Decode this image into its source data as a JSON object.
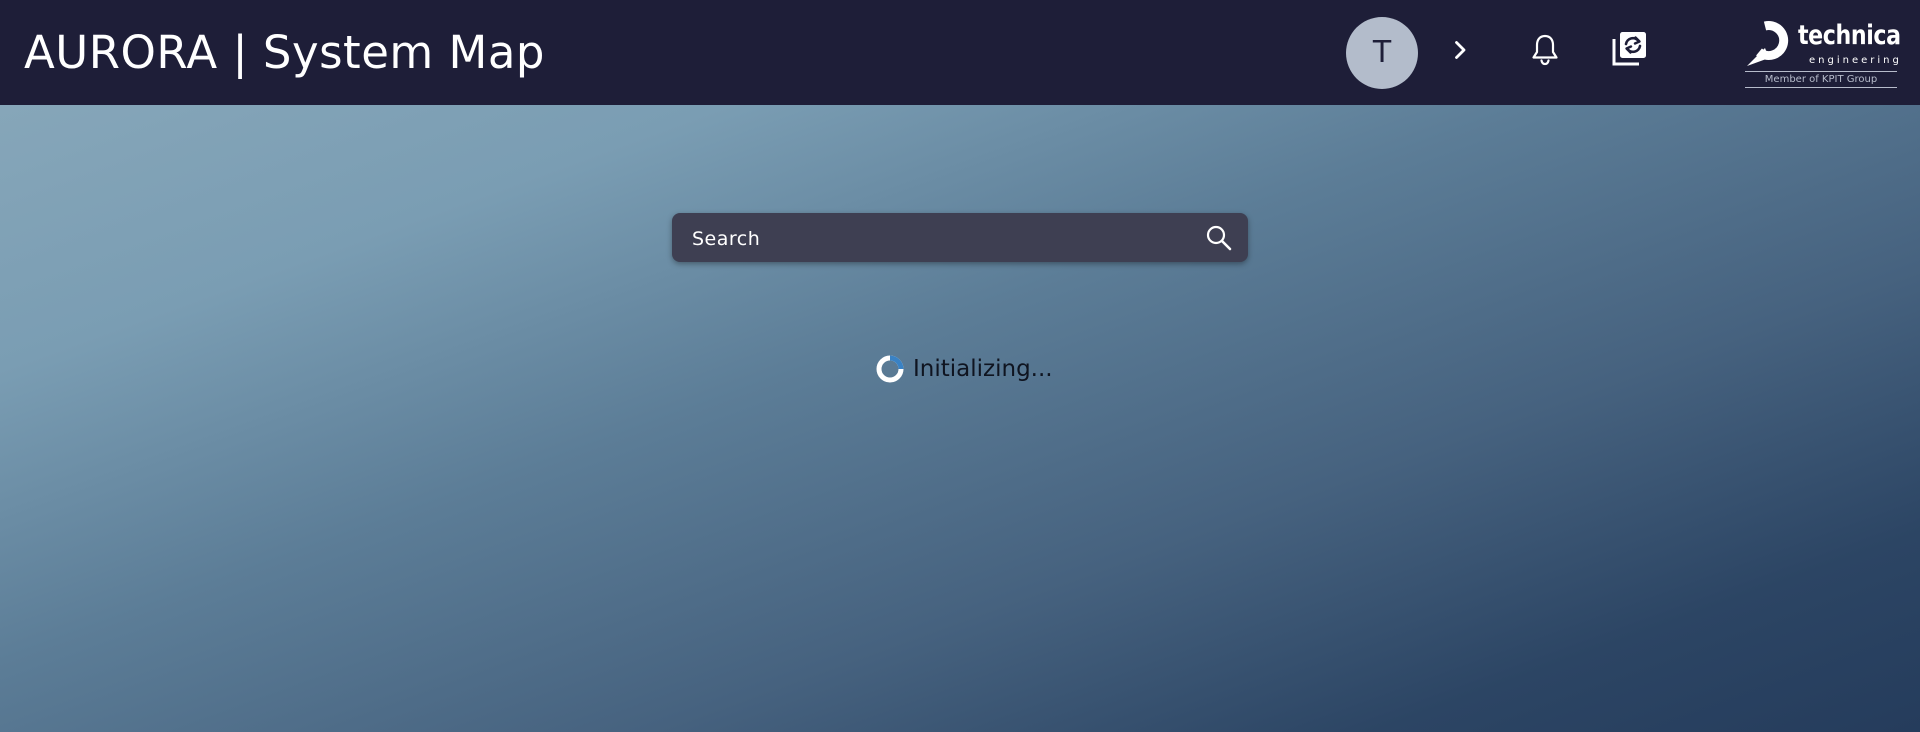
{
  "header": {
    "title": "AURORA | System Map",
    "avatar_initial": "T",
    "chevron_icon": "chevron-right-icon",
    "notifications_icon": "bell-icon",
    "sync_icon": "sync-copy-icon",
    "logo": {
      "name": "technica",
      "subtitle": "engineering",
      "tagline": "Member of KPIT Group"
    },
    "background_color": "#1e1e38",
    "avatar_color": "#b3bccb"
  },
  "search": {
    "placeholder": "Search",
    "icon": "search-icon",
    "background_color": "#3e3f52"
  },
  "status": {
    "text": "Initializing...",
    "icon": "spinner-icon",
    "spinner_color": "#3a82c4"
  }
}
